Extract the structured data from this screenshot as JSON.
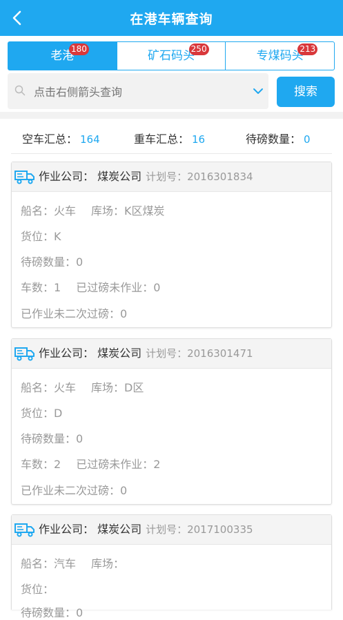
{
  "header": {
    "title": "在港车辆查询"
  },
  "tabs": [
    {
      "label": "老港",
      "badge": "180"
    },
    {
      "label": "矿石码头",
      "badge": "250"
    },
    {
      "label": "专煤码头",
      "badge": "213"
    }
  ],
  "search": {
    "placeholder": "点击右侧箭头查询",
    "button": "搜索"
  },
  "summary": {
    "empty_label": "空车汇总：",
    "empty_value": "164",
    "heavy_label": "重车汇总：",
    "heavy_value": "16",
    "pending_label": "待磅数量：",
    "pending_value": "0"
  },
  "cards": [
    {
      "company": "作业公司：  煤炭公司",
      "plan": "计划号：2016301834",
      "ship": "船名：火车",
      "yard": "库场：K区煤炭",
      "location": "货位：K",
      "pending": "待磅数量：0",
      "cars": "车数：1",
      "weighed": "已过磅未作业：0",
      "not_second": "已作业未二次过磅：0"
    },
    {
      "company": "作业公司：  煤炭公司",
      "plan": "计划号：2016301471",
      "ship": "船名：火车",
      "yard": "库场：D区",
      "location": "货位：D",
      "pending": "待磅数量：0",
      "cars": "车数：2",
      "weighed": "已过磅未作业：2",
      "not_second": "已作业未二次过磅：0"
    },
    {
      "company": "作业公司：  煤炭公司",
      "plan": "计划号：2017100335",
      "ship": "船名：汽车",
      "yard": "库场：",
      "location": "货位：",
      "pending": "待磅数量：0"
    }
  ]
}
